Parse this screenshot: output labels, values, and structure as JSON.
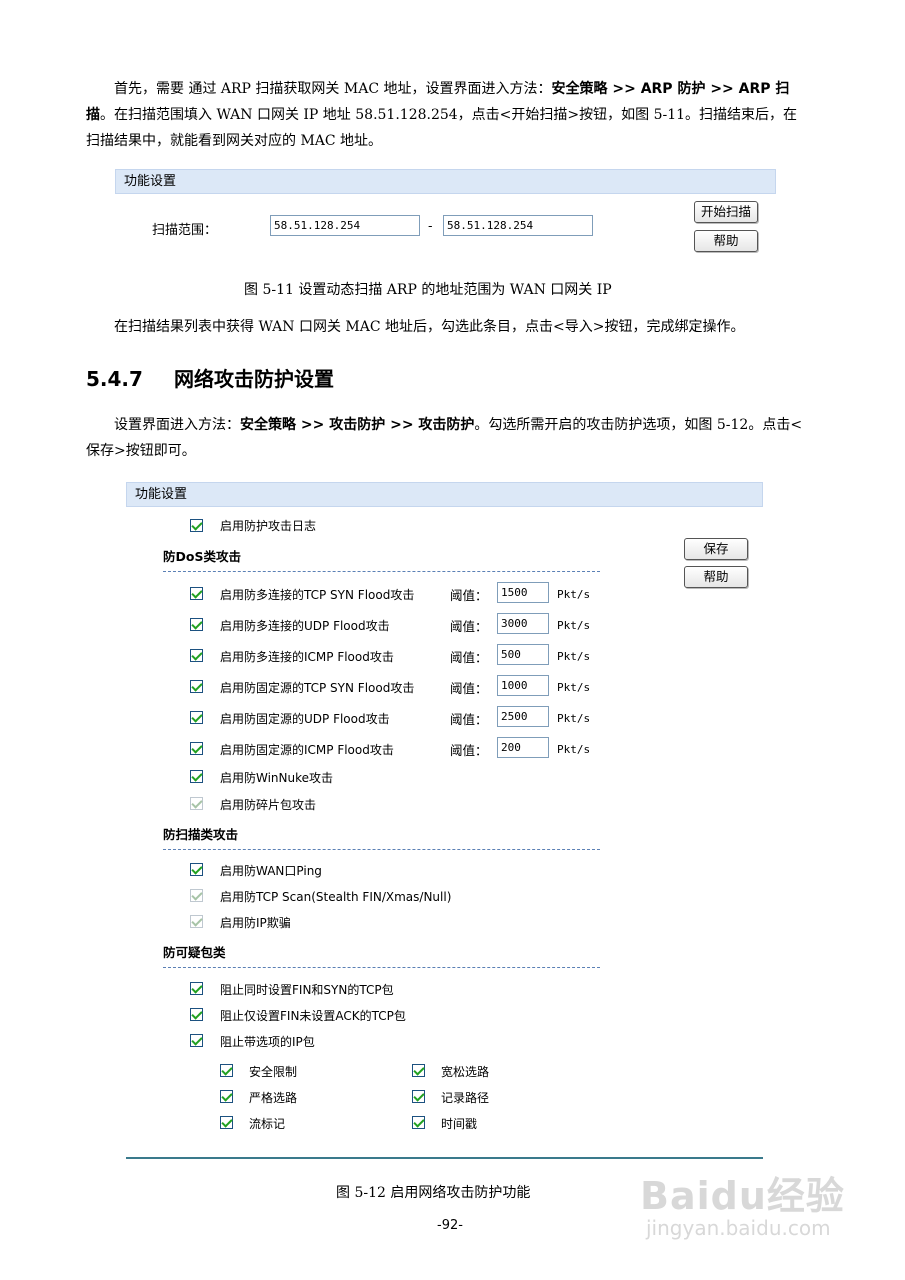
{
  "intro": {
    "p1_a": "首先，需要 通过 ARP 扫描获取网关 MAC 地址，设置界面进入方法：",
    "p1_path": "安全策略 >> ARP 防护 >> ARP 扫描",
    "p1_b": "。在扫描范围填入 WAN 口网关 IP 地址 58.51.128.254，点击<开始扫描>按钮，如图 5-11。扫描结束后，在扫描结果中，就能看到网关对应的 MAC 地址。"
  },
  "fig511": {
    "bar_title": "功能设置",
    "range_label": "扫描范围：",
    "range_start": "58.51.128.254",
    "range_sep": "-",
    "range_end": "58.51.128.254",
    "scan_button": "开始扫描",
    "help_button": "帮助",
    "caption": "图 5-11 设置动态扫描 ARP 的地址范围为 WAN 口网关 IP"
  },
  "after511": "在扫描结果列表中获得 WAN 口网关 MAC 地址后，勾选此条目，点击<导入>按钮，完成绑定操作。",
  "section": {
    "number": "5.4.7",
    "title": "网络攻击防护设置"
  },
  "intro2": {
    "a": "设置界面进入方法：",
    "path": "安全策略 >> 攻击防护 >> 攻击防护",
    "b": "。勾选所需开启的攻击防护选项，如图 5-12。点击<保存>按钮即可。"
  },
  "fig512": {
    "bar_title": "功能设置",
    "log_label": "启用防护攻击日志",
    "save_button": "保存",
    "help_button": "帮助",
    "dos_title": "防DoS类攻击",
    "threshold_label": "阈值：",
    "unit": "Pkt/s",
    "dos_items": [
      {
        "label": "启用防多连接的TCP SYN Flood攻击",
        "threshold": "1500"
      },
      {
        "label": "启用防多连接的UDP Flood攻击",
        "threshold": "3000"
      },
      {
        "label": "启用防多连接的ICMP Flood攻击",
        "threshold": "500"
      },
      {
        "label": "启用防固定源的TCP SYN Flood攻击",
        "threshold": "1000"
      },
      {
        "label": "启用防固定源的UDP Flood攻击",
        "threshold": "2500"
      },
      {
        "label": "启用防固定源的ICMP Flood攻击",
        "threshold": "200"
      }
    ],
    "winnuke_label": "启用防WinNuke攻击",
    "fragment_label": "启用防碎片包攻击",
    "scan_title": "防扫描类攻击",
    "scan_items": [
      "启用防WAN口Ping",
      "启用防TCP Scan(Stealth FIN/Xmas/Null)",
      "启用防IP欺骗"
    ],
    "suspicious_title": "防可疑包类",
    "suspicious_items": [
      "阻止同时设置FIN和SYN的TCP包",
      "阻止仅设置FIN未设置ACK的TCP包",
      "阻止带选项的IP包"
    ],
    "ip_options": [
      "安全限制",
      "宽松选路",
      "严格选路",
      "记录路径",
      "流标记",
      "时间戳"
    ],
    "caption": "图 5-12 启用网络攻击防护功能"
  },
  "page_number": "-92-",
  "watermark": {
    "logo": "Baidu经验",
    "url": "jingyan.baidu.com"
  }
}
